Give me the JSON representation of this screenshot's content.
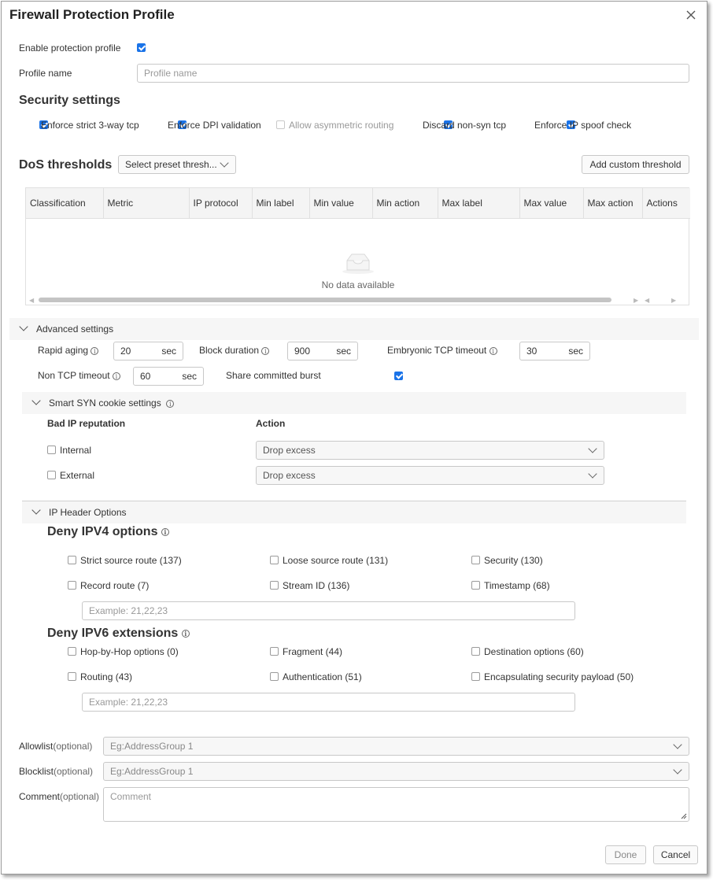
{
  "dialog": {
    "title": "Firewall Protection Profile"
  },
  "profile": {
    "enable_label": "Enable protection profile",
    "enabled": true,
    "name_label": "Profile name",
    "name_placeholder": "Profile name"
  },
  "security": {
    "heading": "Security settings",
    "options": [
      {
        "label": "Enforce strict 3-way tcp",
        "checked": true,
        "disabled": false
      },
      {
        "label": "Enforce DPI validation",
        "checked": true,
        "disabled": false
      },
      {
        "label": "Allow asymmetric routing",
        "checked": false,
        "disabled": true
      },
      {
        "label": "Discard non-syn tcp",
        "checked": true,
        "disabled": false
      },
      {
        "label": "Enforce IP spoof check",
        "checked": true,
        "disabled": false
      }
    ]
  },
  "dos": {
    "heading": "DoS thresholds",
    "preset_placeholder": "Select preset thresh...",
    "add_button": "Add custom threshold",
    "columns": [
      "Classification",
      "Metric",
      "IP protocol",
      "Min label",
      "Min value",
      "Min action",
      "Max label",
      "Max value",
      "Max action",
      "Actions"
    ],
    "empty_text": "No data available"
  },
  "advanced": {
    "heading": "Advanced settings",
    "rapid_aging_label": "Rapid aging",
    "rapid_aging_value": "20",
    "block_duration_label": "Block duration",
    "block_duration_value": "900",
    "embryonic_label": "Embryonic TCP timeout",
    "embryonic_value": "30",
    "non_tcp_label": "Non TCP timeout",
    "non_tcp_value": "60",
    "unit": "sec",
    "share_burst_label": "Share committed burst",
    "share_burst_checked": true
  },
  "syn": {
    "heading": "Smart SYN cookie settings",
    "col_reputation": "Bad IP reputation",
    "col_action": "Action",
    "rows": [
      {
        "label": "Internal",
        "checked": false,
        "action": "Drop excess"
      },
      {
        "label": "External",
        "checked": false,
        "action": "Drop excess"
      }
    ]
  },
  "ip_header": {
    "heading": "IP Header Options",
    "ipv4_heading": "Deny IPV4 options",
    "ipv4_options": [
      "Strict source route (137)",
      "Loose source route (131)",
      "Security (130)",
      "Record route (7)",
      "Stream ID (136)",
      "Timestamp (68)"
    ],
    "ipv4_placeholder": "Example: 21,22,23",
    "ipv6_heading": "Deny IPV6 extensions",
    "ipv6_options": [
      "Hop-by-Hop options (0)",
      "Fragment (44)",
      "Destination options (60)",
      "Routing (43)",
      "Authentication (51)",
      "Encapsulating security payload (50)"
    ],
    "ipv6_placeholder": "Example: 21,22,23"
  },
  "lists": {
    "allowlist_label": "Allowlist",
    "blocklist_label": "Blocklist",
    "comment_label": "Comment",
    "optional": "(optional)",
    "allowlist_placeholder": "Eg:AddressGroup 1",
    "blocklist_placeholder": "Eg:AddressGroup 1",
    "comment_placeholder": "Comment"
  },
  "footer": {
    "done": "Done",
    "cancel": "Cancel"
  },
  "colors": {
    "accent": "#1a73e8"
  }
}
